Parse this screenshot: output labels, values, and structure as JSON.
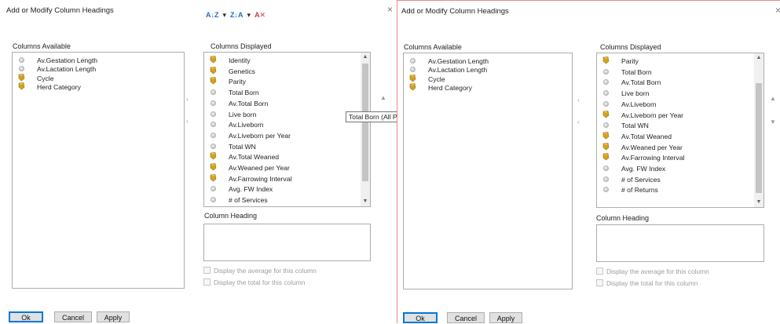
{
  "left": {
    "title": "Add or Modify Column Headings",
    "close_glyph": "×",
    "sort_toolbar": {
      "sort_asc": "A↓Z",
      "sort_desc": "Z↓A",
      "dropdown": "▾",
      "clear_sort": "A✕"
    },
    "columns_available_label": "Columns Available",
    "columns_available": [
      {
        "label": "Av.Gestation Length",
        "icon": "circle"
      },
      {
        "label": "Av.Lactation Length",
        "icon": "circle"
      },
      {
        "label": "Cycle",
        "icon": "key"
      },
      {
        "label": "Herd Category",
        "icon": "key"
      }
    ],
    "columns_displayed_label": "Columns Displayed",
    "columns_displayed": [
      {
        "label": "Identity",
        "icon": "key"
      },
      {
        "label": "Genetics",
        "icon": "key"
      },
      {
        "label": "Parity",
        "icon": "key"
      },
      {
        "label": "Total Born",
        "icon": "circle"
      },
      {
        "label": "Av.Total Born",
        "icon": "circle"
      },
      {
        "label": "Live born",
        "icon": "circle"
      },
      {
        "label": "Av.Liveborn",
        "icon": "circle"
      },
      {
        "label": "Av.Liveborn per Year",
        "icon": "circle"
      },
      {
        "label": "Total WN",
        "icon": "circle"
      },
      {
        "label": "Av.Total Weaned",
        "icon": "key"
      },
      {
        "label": "Av.Weaned per Year",
        "icon": "key"
      },
      {
        "label": "Av.Farrowing Interval",
        "icon": "key"
      },
      {
        "label": "Avg. FW Index",
        "icon": "circle"
      },
      {
        "label": "# of Services",
        "icon": "circle"
      }
    ],
    "move_right": "›",
    "move_left": "‹",
    "move_up": "▲",
    "move_down": "▼",
    "tooltip": "Total Born  (All P",
    "column_heading_label": "Column Heading",
    "display_average": "Display the average for this column",
    "display_total": "Display the total for this column",
    "buttons": {
      "ok": "Ok",
      "cancel": "Cancel",
      "apply": "Apply"
    }
  },
  "right": {
    "title": "Add or Modify Column Headings",
    "close_glyph": "×",
    "columns_available_label": "Columns Available",
    "columns_available": [
      {
        "label": "Av.Gestation Length",
        "icon": "circle"
      },
      {
        "label": "Av.Lactation Length",
        "icon": "circle"
      },
      {
        "label": "Cycle",
        "icon": "key"
      },
      {
        "label": "Herd Category",
        "icon": "key"
      }
    ],
    "columns_displayed_label": "Columns Displayed",
    "columns_displayed": [
      {
        "label": "Parity",
        "icon": "key"
      },
      {
        "label": "Total Born",
        "icon": "circle"
      },
      {
        "label": "Av.Total Born",
        "icon": "circle"
      },
      {
        "label": "Live born",
        "icon": "circle"
      },
      {
        "label": "Av.Liveborn",
        "icon": "circle"
      },
      {
        "label": "Av.Liveborn per Year",
        "icon": "key"
      },
      {
        "label": "Total WN",
        "icon": "circle"
      },
      {
        "label": "Av.Total Weaned",
        "icon": "key"
      },
      {
        "label": "Av.Weaned per Year",
        "icon": "key"
      },
      {
        "label": "Av.Farrowing Interval",
        "icon": "key"
      },
      {
        "label": "Avg. FW Index",
        "icon": "circle"
      },
      {
        "label": "# of Services",
        "icon": "circle"
      },
      {
        "label": "# of Returns",
        "icon": "circle"
      }
    ],
    "move_right": "›",
    "move_left": "‹",
    "move_up": "▲",
    "move_down": "▼",
    "column_heading_label": "Column Heading",
    "display_average": "Display the average for this column",
    "display_total": "Display the total for this column",
    "buttons": {
      "ok": "Ok",
      "cancel": "Cancel",
      "apply": "Apply"
    }
  }
}
